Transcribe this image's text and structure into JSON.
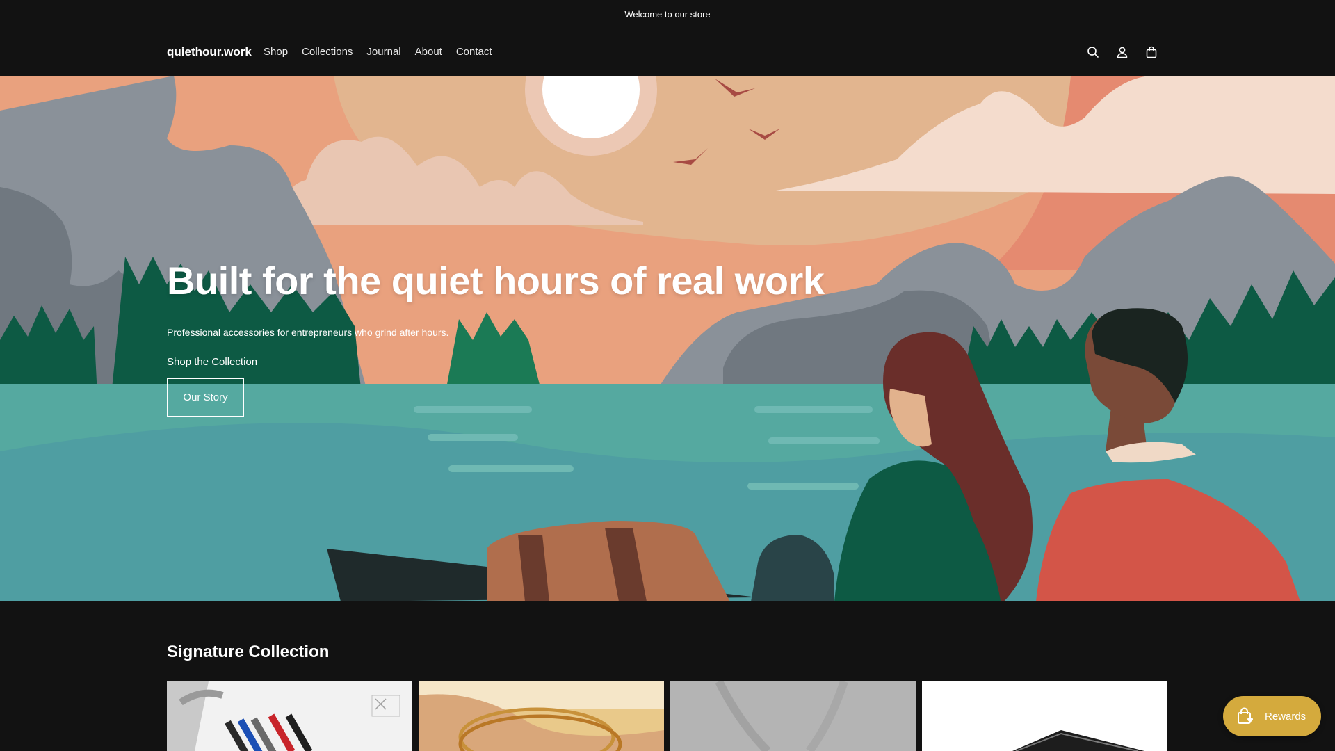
{
  "announcement": {
    "text": "Welcome to our store"
  },
  "header": {
    "logo": "quiethour.work",
    "nav": [
      "Shop",
      "Collections",
      "Journal",
      "About",
      "Contact"
    ],
    "icons": [
      "search-icon",
      "account-icon",
      "cart-icon"
    ]
  },
  "hero": {
    "title": "Built for the quiet hours of real work",
    "subtitle": "Professional accessories for entrepreneurs who grind after hours.",
    "link_label": "Shop the Collection",
    "button_label": "Our Story"
  },
  "signature": {
    "title": "Signature Collection",
    "products": [
      "pens-product-image",
      "bracelets-product-image",
      "grey-product-image",
      "box-product-image"
    ]
  },
  "rewards": {
    "label": "Rewards"
  },
  "colors": {
    "background": "#121212",
    "rewards_button": "#d4aa3d",
    "sky": "#e9a17e",
    "water": "#4f9ea2"
  }
}
